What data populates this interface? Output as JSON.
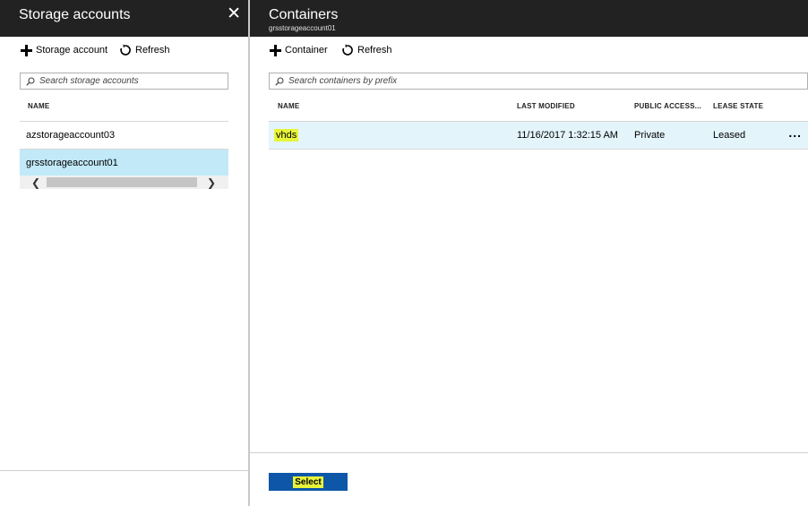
{
  "left_blade": {
    "title": "Storage accounts",
    "close_label": "✕",
    "toolbar": {
      "add_label": "Storage account",
      "refresh_label": "Refresh"
    },
    "search": {
      "placeholder": "Search storage accounts"
    },
    "column_header": "NAME",
    "accounts": [
      {
        "name": "azstorageaccount03",
        "selected": false
      },
      {
        "name": "grsstorageaccount01",
        "selected": true
      }
    ],
    "scroll_left": "❮",
    "scroll_right": "❯"
  },
  "right_blade": {
    "title": "Containers",
    "subtitle": "grsstorageaccount01",
    "toolbar": {
      "add_label": "Container",
      "refresh_label": "Refresh"
    },
    "search": {
      "placeholder": "Search containers by prefix"
    },
    "columns": [
      "NAME",
      "LAST MODIFIED",
      "PUBLIC ACCESS...",
      "LEASE STATE"
    ],
    "rows": [
      {
        "name": "vhds",
        "last_modified": "11/16/2017 1:32:15 AM",
        "public_access": "Private",
        "lease_state": "Leased",
        "more": "..."
      }
    ],
    "select_label": "Select"
  },
  "colors": {
    "header_bg": "#222222",
    "selected_row": "#c1e9f7",
    "highlight": "#e7f53a",
    "select_button": "#0e57a8"
  }
}
